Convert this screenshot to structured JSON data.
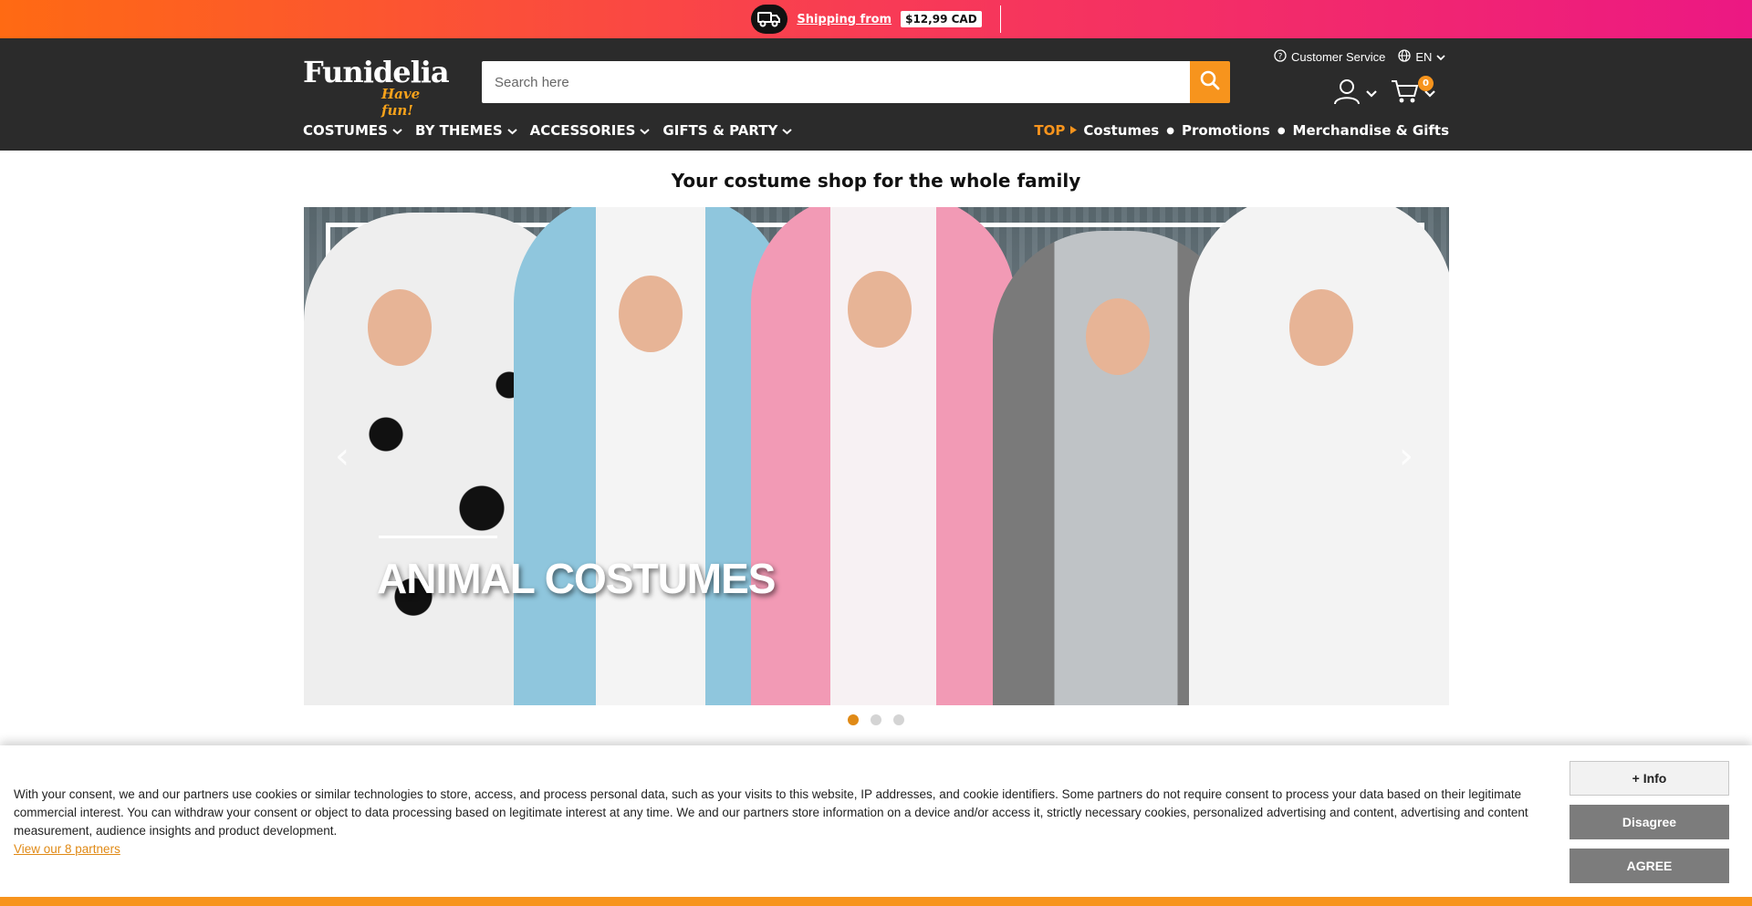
{
  "promo": {
    "shipping_label": "Shipping from",
    "shipping_price": "$12,99 CAD"
  },
  "header": {
    "logo_text": "Funidelia",
    "logo_tagline": "Have fun!",
    "search_placeholder": "Search here",
    "customer_service": "Customer Service",
    "language": "EN",
    "cart_count": "0"
  },
  "nav": {
    "left": [
      "COSTUMES",
      "BY THEMES",
      "ACCESSORIES",
      "GIFTS & PARTY"
    ],
    "top_label": "TOP",
    "right": [
      "Costumes",
      "Promotions",
      "Merchandise & Gifts"
    ]
  },
  "main": {
    "title": "Your costume shop for the whole family",
    "hero_title": "ANIMAL COSTUMES",
    "carousel_slide_count": 3,
    "carousel_active_index": 0
  },
  "cookie": {
    "text": "With your consent, we and our partners use cookies or similar technologies to store, access, and process personal data, such as your visits to this website, IP addresses, and cookie identifiers. Some partners do not require consent to process your data based on their legitimate commercial interest. You can withdraw your consent or object to data processing based on legitimate interest at any time. We and our partners store information on a device and/or access it, strictly necessary cookies, personalized advertising and content, advertising and content measurement, audience insights and product development.",
    "partners_link": "View our 8 partners",
    "info_button": "+ Info",
    "disagree_button": "Disagree",
    "agree_button": "AGREE"
  },
  "colors": {
    "accent": "#f7941d",
    "header_bg": "#2b2b2b",
    "promo_gradient_start": "#ff6a13",
    "promo_gradient_end": "#ec1883"
  },
  "icons": {
    "truck": "truck-icon",
    "search": "search-icon",
    "help": "question-circle-icon",
    "globe": "globe-icon",
    "user": "user-icon",
    "cart": "cart-icon",
    "chevron": "chevron-down-icon",
    "arrow_left": "chevron-left-icon",
    "arrow_right": "chevron-right-icon"
  }
}
